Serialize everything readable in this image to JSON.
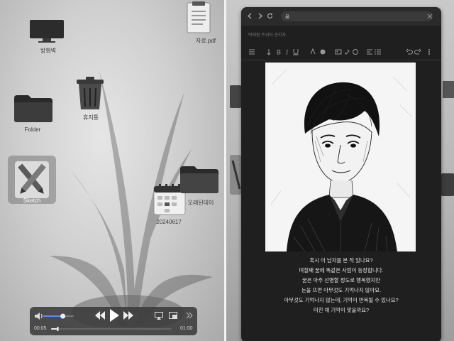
{
  "desktop": {
    "icons": [
      {
        "name": "monitor",
        "label": "방화벽"
      },
      {
        "name": "trash",
        "label": "휴지통"
      },
      {
        "name": "folder-1",
        "label": "Folder"
      },
      {
        "name": "sketch",
        "label": "Sketch"
      },
      {
        "name": "calendar",
        "label": "20240617"
      },
      {
        "name": "document",
        "label": "자료.pdf"
      },
      {
        "name": "folder-2",
        "label": "오래된데이"
      }
    ]
  },
  "media_player": {
    "elapsed": "00:05",
    "total": "01:00",
    "progress": 0.05,
    "volume": 0.65
  },
  "browser": {
    "page_title": "박태원 트위터 관리자",
    "caption_lines": [
      "혹시 이 남자를 본 적 있나요?",
      "며칠째 꿈에 똑같은 사람이 등장합니다.",
      "꿈은 아주 선명할 정도로 행복했지만",
      "눈을 뜨면 아무것도 기억나지 않아요.",
      "아무것도 기억나지 않는데, 기억이 반복될 수 있나요?",
      "미친 채 기억이 맞을까요?"
    ]
  },
  "colors": {
    "window_bg": "#1f1f1f",
    "media_accent": "#5a8ee6",
    "caption_text": "#e4e4e4"
  }
}
